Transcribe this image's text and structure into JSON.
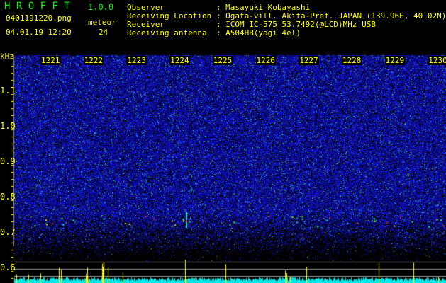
{
  "header": {
    "app_title": "H R O F F T",
    "version": "1.0.0",
    "filename": "0401191220.png",
    "meteor_label": "meteor",
    "datetime": "04.01.19 12:20",
    "meteor_count": "24"
  },
  "info": [
    {
      "label": "Observer",
      "value": "Masayuki Kobayashi"
    },
    {
      "label": "Receiving Location",
      "value": "Ogata-vill. Akita-Pref. JAPAN (139.96E, 40.02N)"
    },
    {
      "label": "Receiver",
      "value": "ICOM IC-575 53.7492(@LCD)MHz USB"
    },
    {
      "label": "Receiving antenna",
      "value": "A504HB(yagi 4el)"
    }
  ],
  "axis": {
    "unit": "kHz",
    "freq_ticks": [
      "1.1",
      "1.0",
      "0.9",
      "0.8",
      "0.7",
      "0.6"
    ],
    "time_ticks": [
      "1221",
      "1222",
      "1223",
      "1224",
      "1225",
      "1226",
      "1227",
      "1228",
      "1229",
      "1230"
    ]
  },
  "colors": {
    "label": "#ffff00",
    "title": "#11ee11",
    "noise": "#1010d0",
    "histogram": "#00e8e8",
    "meteor_spike": "#ffff00"
  }
}
